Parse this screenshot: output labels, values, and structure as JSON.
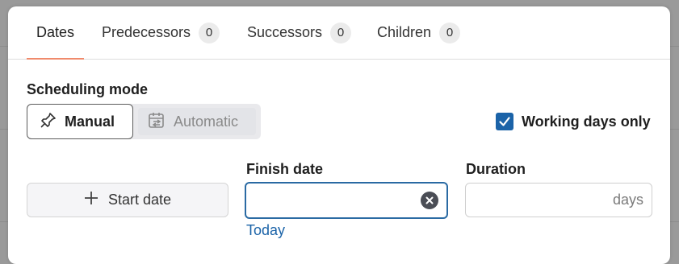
{
  "tabs": [
    {
      "label": "Dates",
      "count": null,
      "active": true
    },
    {
      "label": "Predecessors",
      "count": "0",
      "active": false
    },
    {
      "label": "Successors",
      "count": "0",
      "active": false
    },
    {
      "label": "Children",
      "count": "0",
      "active": false
    }
  ],
  "scheduling": {
    "label": "Scheduling mode",
    "manual_label": "Manual",
    "automatic_label": "Automatic",
    "selected": "Manual"
  },
  "working_days": {
    "label": "Working days only",
    "checked": true
  },
  "start_date": {
    "button_label": "Start date"
  },
  "finish_date": {
    "label": "Finish date",
    "value": "",
    "today_link": "Today"
  },
  "duration": {
    "label": "Duration",
    "unit": "days",
    "value": ""
  },
  "colors": {
    "accent": "#1b63a8",
    "tab_underline": "#f08a6c",
    "focus_border": "#2a6aa3"
  }
}
